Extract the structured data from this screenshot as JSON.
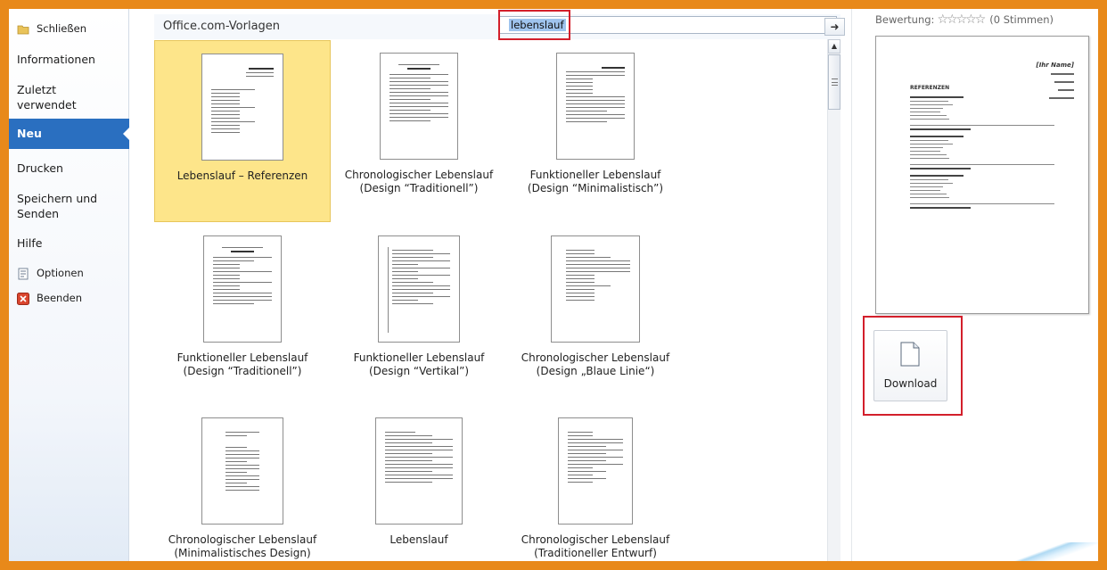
{
  "nav": {
    "close": "Schließen",
    "info": "Informationen",
    "recent": "Zuletzt verwendet",
    "new": "Neu",
    "print": "Drucken",
    "save_send": "Speichern und Senden",
    "help": "Hilfe",
    "options": "Optionen",
    "exit": "Beenden"
  },
  "gallery": {
    "title": "Office.com-Vorlagen",
    "search_value": "lebenslauf",
    "go_icon": "arrow-right-icon"
  },
  "templates": [
    {
      "name": "Lebenslauf – Referenzen",
      "selected": true
    },
    {
      "name": "Chronologischer Lebenslauf (Design “Traditionell”)"
    },
    {
      "name": "Funktioneller Lebenslauf (Design “Minimalistisch”)"
    },
    {
      "name": "Funktioneller Lebenslauf (Design “Traditionell”)"
    },
    {
      "name": "Funktioneller Lebenslauf (Design “Vertikal”)"
    },
    {
      "name": "Chronologischer Lebenslauf (Design „Blaue Linie“)"
    },
    {
      "name": "Chronologischer Lebenslauf (Minimalistisches Design)"
    },
    {
      "name": "Lebenslauf"
    },
    {
      "name": "Chronologischer Lebenslauf (Traditioneller Entwurf)"
    }
  ],
  "preview": {
    "rating_label": "Bewertung:",
    "stars_filled": 0,
    "stars_total": 5,
    "votes": "(0 Stimmen)",
    "doc_name": "[Ihr Name]",
    "doc_heading": "REFERENZEN",
    "download_label": "Download"
  },
  "colors": {
    "accent": "#2a6fc0",
    "selected_bg": "#fde58a",
    "highlight": "#d31f2b",
    "frame": "#e8891a"
  }
}
